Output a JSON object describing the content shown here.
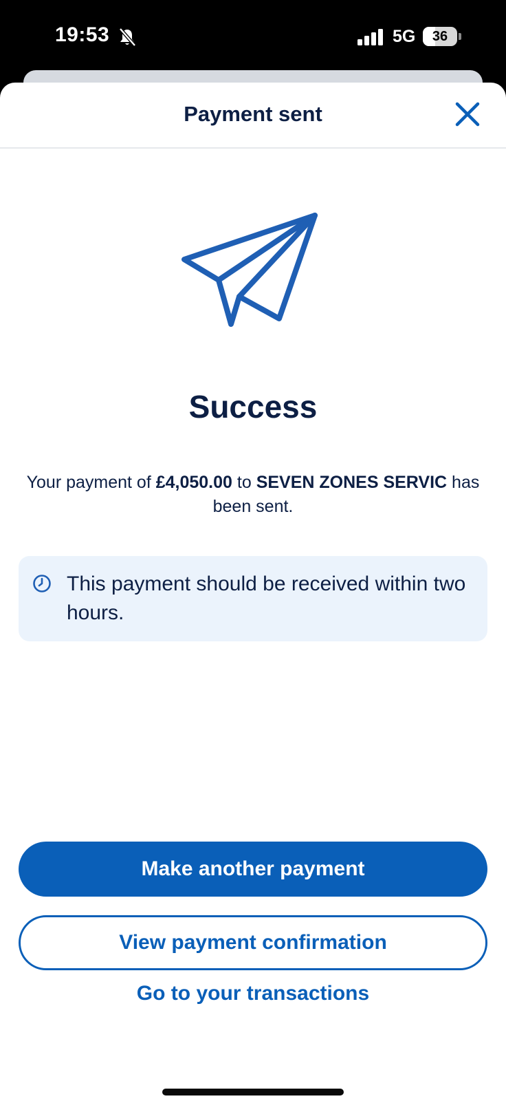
{
  "status_bar": {
    "time": "19:53",
    "network": "5G",
    "battery_level": "36",
    "battery_fraction": 0.36,
    "icons": [
      "bell-slash-icon",
      "cellular-signal-icon",
      "battery-icon"
    ]
  },
  "header": {
    "title": "Payment sent",
    "close_icon": "close-icon"
  },
  "illustration": {
    "icon": "paper-plane-icon"
  },
  "success": {
    "heading": "Success",
    "message_prefix": "Your payment of ",
    "amount": "£4,050.00",
    "message_middle": " to ",
    "recipient": "SEVEN ZONES SERVIC",
    "message_suffix": " has been sent."
  },
  "info": {
    "icon": "clock-icon",
    "text": "This payment should be received within two hours."
  },
  "actions": {
    "primary_label": "Make another payment",
    "secondary_label": "View payment confirmation",
    "link_label": "Go to your transactions"
  },
  "colors": {
    "brand_blue": "#0a5fb8",
    "navy_text": "#0d1f44",
    "info_background": "#ebf3fc"
  }
}
